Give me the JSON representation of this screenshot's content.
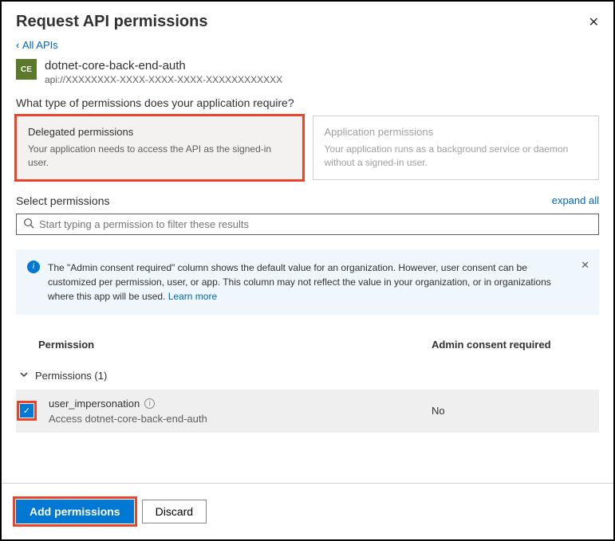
{
  "header": {
    "title": "Request API permissions"
  },
  "back_link": "All APIs",
  "app": {
    "badge": "CE",
    "name": "dotnet-core-back-end-auth",
    "uri": "api://XXXXXXXX-XXXX-XXXX-XXXX-XXXXXXXXXXXX"
  },
  "question": "What type of permissions does your application require?",
  "cards": {
    "delegated": {
      "title": "Delegated permissions",
      "desc": "Your application needs to access the API as the signed-in user."
    },
    "application": {
      "title": "Application permissions",
      "desc": "Your application runs as a background service or daemon without a signed-in user."
    }
  },
  "select": {
    "label": "Select permissions",
    "expand": "expand all"
  },
  "search": {
    "placeholder": "Start typing a permission to filter these results"
  },
  "callout": {
    "text": "The \"Admin consent required\" column shows the default value for an organization. However, user consent can be customized per permission, user, or app. This column may not reflect the value in your organization, or in organizations where this app will be used.  ",
    "learn": "Learn more"
  },
  "table": {
    "col_permission": "Permission",
    "col_consent": "Admin consent required",
    "group": "Permissions (1)",
    "rows": [
      {
        "name": "user_impersonation",
        "desc": "Access dotnet-core-back-end-auth",
        "consent": "No",
        "checked": true
      }
    ]
  },
  "actions": {
    "add": "Add permissions",
    "discard": "Discard"
  }
}
